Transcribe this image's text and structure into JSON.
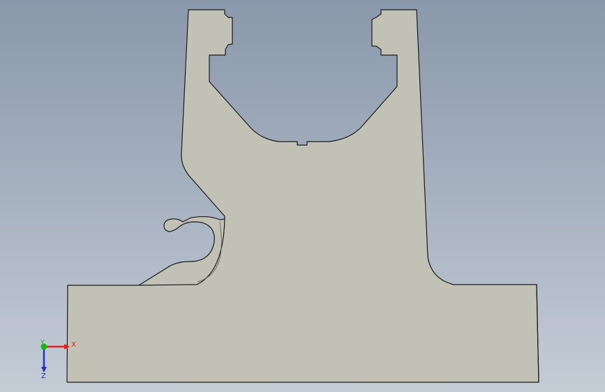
{
  "viewport": {
    "background_top": "#8a98ab",
    "background_bottom": "#c4ccd6",
    "part_fill": "#c2c1b6",
    "part_edge": "#1a1a1a"
  },
  "triad": {
    "x_label": "X",
    "y_label": "Y",
    "z_label": "Z",
    "x_color": "#e02020",
    "y_color": "#18b818",
    "z_color": "#2030c8"
  }
}
